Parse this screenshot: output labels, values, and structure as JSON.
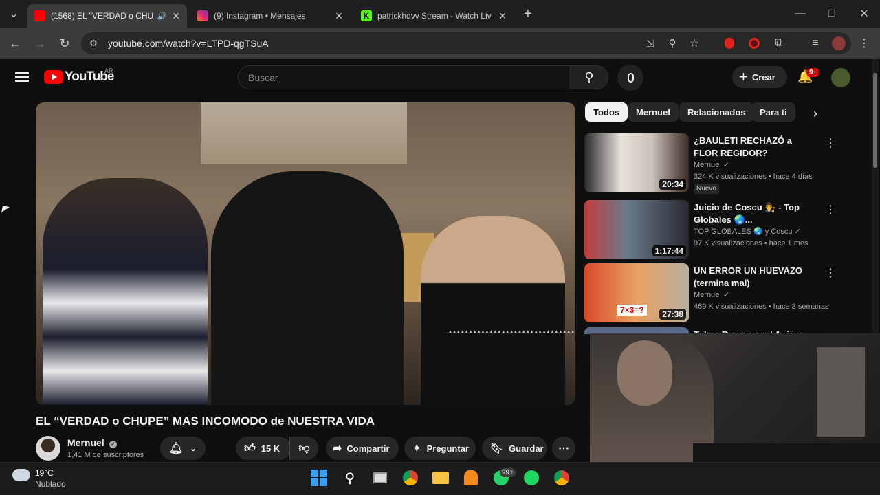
{
  "browser": {
    "tabs": [
      {
        "title": "(1568) EL \"VERDAD o CHUPE",
        "active": true
      },
      {
        "title": "(9) Instagram • Mensajes",
        "active": false
      },
      {
        "title": "patrickhdvv Stream - Watch Liv",
        "active": false
      }
    ],
    "url": "youtube.com/watch?v=LTPD-qgTSuA",
    "new_tab": "+"
  },
  "youtube": {
    "logo": "YouTube",
    "country": "AR",
    "search_placeholder": "Buscar",
    "create_label": "Crear",
    "notif_badge": "9+",
    "video_title": "EL “VERDAD o CHUPE” MAS INCOMODO de NUESTRA VIDA",
    "channel_name": "Mernuel",
    "subscribers": "1,41 M de suscriptores",
    "likes": "15 K",
    "share_label": "Compartir",
    "ask_label": "Preguntar",
    "save_label": "Guardar",
    "chips": [
      "Todos",
      "Mernuel",
      "Relacionados",
      "Para ti"
    ],
    "related": [
      {
        "title": "¿BAULETI RECHAZÓ a FLOR REGIDOR?",
        "channel": "Mernuel",
        "meta": "324 K visualizaciones • hace 4 días",
        "badge": "Nuevo",
        "duration": "20:34"
      },
      {
        "title": "Juicio de Coscu 👨‍⚖️ - Top Globales 🌏...",
        "channel": "TOP GLOBALES 🌏 y Coscu",
        "meta": "97 K visualizaciones • hace 1 mes",
        "duration": "1:17:44"
      },
      {
        "title": "UN ERROR UN HUEVAZO (termina mal)",
        "channel": "Mernuel",
        "meta": "469 K visualizaciones • hace 3 semanas",
        "duration": "27:38",
        "thumb_text": "7×3=?"
      },
      {
        "title": "Tokyo Revengers | Anime"
      }
    ]
  },
  "taskbar": {
    "temp": "19°C",
    "weather": "Nublado",
    "whatsapp_badge": "99+"
  },
  "colors": {
    "yt_red": "#ff0000",
    "bg": "#0f0f0f",
    "chip": "#272727"
  }
}
